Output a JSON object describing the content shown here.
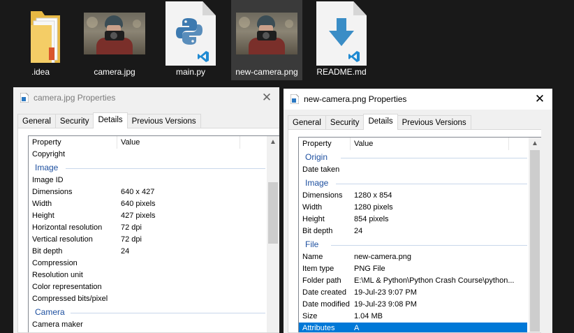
{
  "files": [
    {
      "name": ".idea",
      "icon": "folder-icon"
    },
    {
      "name": "camera.jpg",
      "icon": "photo-thumbnail"
    },
    {
      "name": "main.py",
      "icon": "python-file-icon"
    },
    {
      "name": "new-camera.png",
      "icon": "photo-thumbnail"
    },
    {
      "name": "README.md",
      "icon": "markdown-file-icon"
    }
  ],
  "left_dialog": {
    "title": "camera.jpg Properties",
    "tabs": [
      "General",
      "Security",
      "Details",
      "Previous Versions"
    ],
    "active_tab": "Details",
    "columns": {
      "property": "Property",
      "value": "Value"
    },
    "rows": [
      {
        "property": "Copyright",
        "value": ""
      },
      {
        "group": "Image"
      },
      {
        "property": "Image ID",
        "value": ""
      },
      {
        "property": "Dimensions",
        "value": "640 x 427"
      },
      {
        "property": "Width",
        "value": "640 pixels"
      },
      {
        "property": "Height",
        "value": "427 pixels"
      },
      {
        "property": "Horizontal resolution",
        "value": "72 dpi"
      },
      {
        "property": "Vertical resolution",
        "value": "72 dpi"
      },
      {
        "property": "Bit depth",
        "value": "24"
      },
      {
        "property": "Compression",
        "value": ""
      },
      {
        "property": "Resolution unit",
        "value": ""
      },
      {
        "property": "Color representation",
        "value": ""
      },
      {
        "property": "Compressed bits/pixel",
        "value": ""
      },
      {
        "group": "Camera"
      },
      {
        "property": "Camera maker",
        "value": ""
      }
    ]
  },
  "right_dialog": {
    "title": "new-camera.png Properties",
    "tabs": [
      "General",
      "Security",
      "Details",
      "Previous Versions"
    ],
    "active_tab": "Details",
    "columns": {
      "property": "Property",
      "value": "Value"
    },
    "rows": [
      {
        "group": "Origin"
      },
      {
        "property": "Date taken",
        "value": ""
      },
      {
        "group": "Image"
      },
      {
        "property": "Dimensions",
        "value": "1280 x 854"
      },
      {
        "property": "Width",
        "value": "1280 pixels"
      },
      {
        "property": "Height",
        "value": "854 pixels"
      },
      {
        "property": "Bit depth",
        "value": "24"
      },
      {
        "group": "File"
      },
      {
        "property": "Name",
        "value": "new-camera.png"
      },
      {
        "property": "Item type",
        "value": "PNG File"
      },
      {
        "property": "Folder path",
        "value": "E:\\ML & Python\\Python Crash Course\\python..."
      },
      {
        "property": "Date created",
        "value": "19-Jul-23 9:07 PM"
      },
      {
        "property": "Date modified",
        "value": "19-Jul-23 9:08 PM"
      },
      {
        "property": "Size",
        "value": "1.04 MB"
      },
      {
        "property": "Attributes",
        "value": "A",
        "selected": true
      }
    ]
  },
  "colors": {
    "selection": "#0078d7",
    "group_header": "#1e50a0",
    "python_blue": "#3d7ab0",
    "vscode_blue": "#1f8ad2"
  }
}
